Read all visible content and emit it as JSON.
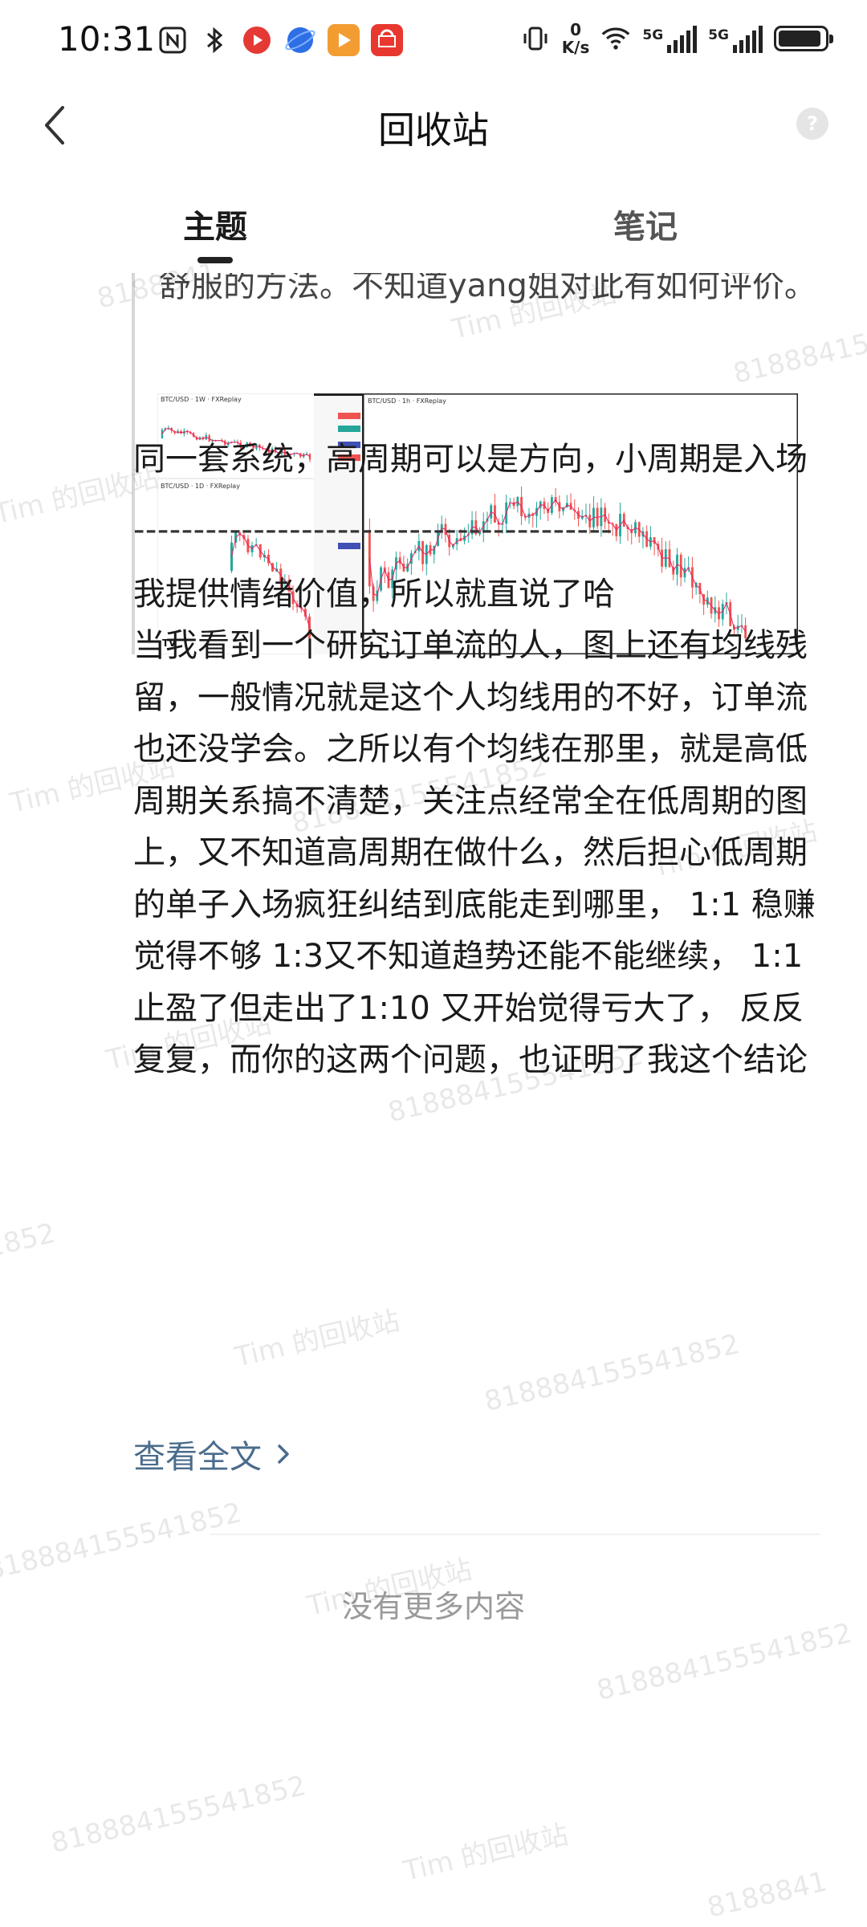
{
  "status_bar": {
    "time": "10:31",
    "net_speed_value": "0",
    "net_speed_unit": "K/s",
    "sim1": "5G",
    "sim2": "5G",
    "app_icon_label": "HUAWEI",
    "battery_level": 0.92
  },
  "header": {
    "title": "回收站",
    "help_icon": "?"
  },
  "tabs": [
    {
      "label": "主题",
      "selected": true
    },
    {
      "label": "笔记",
      "selected": false
    }
  ],
  "post": {
    "quote_text": "舒服的方法。不知道yang姐对此有如何评价。",
    "chart_titles": {
      "weekly": "BTC/USD · 1W · FXReplay",
      "daily": "BTC/USD · 1D · FXReplay",
      "hourly": "BTC/USD · 1h · FXReplay"
    },
    "paragraph1": "同一套系统，高周期可以是方向，小周期是入场",
    "separator": "----------------------------------------",
    "paragraph2": "我提供情绪价值，所以就直说了哈",
    "paragraph3": "当我看到一个研究订单流的人，图上还有均线残留，一般情况就是这个人均线用的不好，订单流也还没学会。之所以有个均线在那里，就是高低周期关系搞不清楚，关注点经常全在低周期的图上，又不知道高周期在做什么，然后担心低周期的单子入场疯狂纠结到底能走到哪里， 1:1 稳赚觉得不够 1:3又不知道趋势还能不能继续， 1:1止盈了但走出了1:10 又开始觉得亏大了， 反反复复，而你的这两个问题，也证明了我这个结论",
    "read_more": "查看全文"
  },
  "footer": {
    "no_more": "没有更多内容"
  },
  "watermarks": {
    "name": "Tim 的回收站",
    "number": "818884155541852",
    "name_partial": "Tim 的回收",
    "number_partial": "8188841",
    "number_tail": "541852"
  },
  "colors": {
    "link": "#4a6c8c",
    "bull_candle": "#26a69a",
    "bear_candle": "#ef5350",
    "ma_line": "#e91e63"
  }
}
